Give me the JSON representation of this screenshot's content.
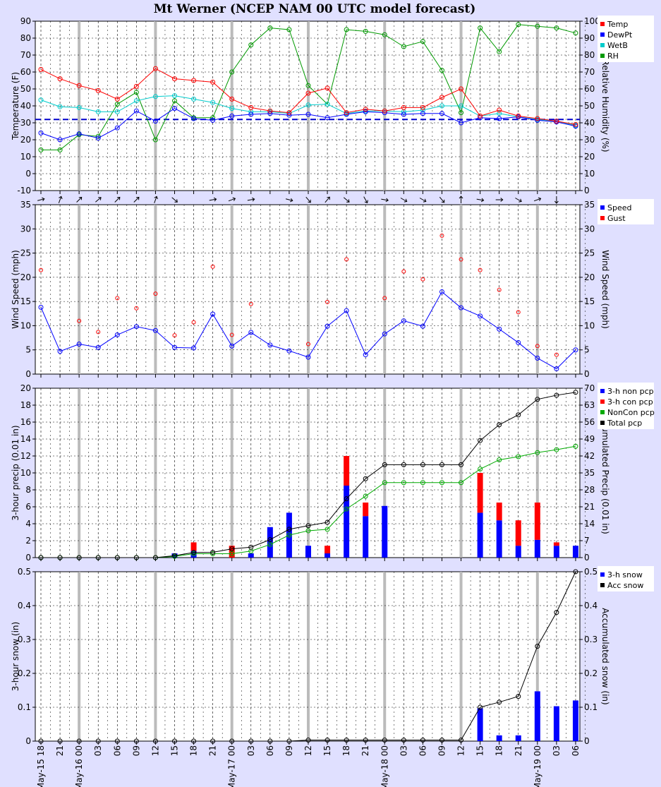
{
  "title": "Mt Werner (NCEP NAM 00 UTC model forecast)",
  "time_labels": [
    "May-15 18",
    "21",
    "May-16 00",
    "03",
    "06",
    "09",
    "12",
    "15",
    "18",
    "21",
    "May-17 00",
    "03",
    "06",
    "09",
    "12",
    "15",
    "18",
    "21",
    "May-18 00",
    "03",
    "06",
    "09",
    "12",
    "15",
    "18",
    "21",
    "May-19 00",
    "03",
    "06"
  ],
  "colors": {
    "background": "#e0e0ff",
    "temp": "#ff0000",
    "dewpt": "#0000ff",
    "wetb": "#00cccc",
    "rh": "#009900",
    "freezing_line": "#0000cc",
    "grid": "#000000",
    "vgrid": "#bbbbbb",
    "legend_bg": "#ffffff"
  },
  "chart_data": [
    {
      "type": "line",
      "panel": "temperature",
      "ylabel": "Temperature (F)",
      "y2label": "Relative Humidity (%)",
      "ylim": [
        -10,
        90
      ],
      "y2lim": [
        0,
        100
      ],
      "yticks": [
        "-10",
        "0",
        "10",
        "20",
        "30",
        "40",
        "50",
        "60",
        "70",
        "80",
        "90"
      ],
      "y2ticks": [
        "0",
        "10",
        "20",
        "30",
        "40",
        "50",
        "60",
        "70",
        "80",
        "90",
        "100"
      ],
      "reference_line": 32,
      "series": [
        {
          "name": "Temp",
          "axis": "left",
          "values": [
            61.5,
            56,
            52,
            49,
            44,
            51.5,
            62,
            56,
            55,
            54,
            44,
            39,
            37,
            36,
            47.5,
            50.5,
            36,
            38,
            37,
            39,
            39,
            45,
            50,
            34,
            37.5,
            34,
            32.5,
            31,
            29
          ]
        },
        {
          "name": "DewPt",
          "axis": "left",
          "values": [
            24,
            20,
            23.5,
            21,
            27,
            37,
            31,
            38.5,
            32.5,
            31.5,
            34,
            35,
            35.5,
            34.5,
            35,
            33,
            35,
            36.5,
            36,
            35,
            35.5,
            35.5,
            30,
            33,
            32.5,
            33.5,
            31.5,
            30.5,
            28
          ]
        },
        {
          "name": "WetB",
          "axis": "left",
          "values": [
            43.5,
            39.5,
            39,
            36.5,
            36.5,
            43,
            45.5,
            46,
            44,
            42,
            38.5,
            36.5,
            36.5,
            35.5,
            40.5,
            41,
            35.5,
            37,
            37,
            36.5,
            37.5,
            40,
            40,
            34,
            35.5,
            33.5,
            32,
            31,
            28.5
          ]
        },
        {
          "name": "RH",
          "axis": "right",
          "values": [
            24,
            24,
            33,
            32,
            51,
            58,
            30,
            53,
            43,
            43,
            70,
            86,
            96,
            95,
            62,
            51,
            95,
            94,
            92,
            85,
            88,
            71,
            46,
            96,
            82,
            98,
            97,
            96,
            93
          ]
        }
      ]
    },
    {
      "type": "scatter",
      "panel": "wind",
      "ylabel": "Wind Speed (mph)",
      "y2label": "Wind Speed (mph)",
      "ylim": [
        0,
        35
      ],
      "yticks": [
        "0",
        "5",
        "10",
        "15",
        "20",
        "25",
        "30",
        "35"
      ],
      "series": [
        {
          "name": "Speed",
          "values": [
            13.8,
            4.7,
            6.2,
            5.5,
            8.1,
            9.8,
            9,
            5.5,
            5.4,
            12.4,
            5.8,
            8.6,
            6,
            4.8,
            3.5,
            9.9,
            13.1,
            4,
            8.3,
            11,
            9.9,
            17,
            13.7,
            12,
            9.3,
            6.5,
            3.3,
            1.1,
            5
          ]
        },
        {
          "name": "Gust",
          "values": [
            21.5,
            null,
            11,
            8.7,
            15.7,
            13.6,
            16.6,
            8,
            10.7,
            22.2,
            8.1,
            14.5,
            null,
            null,
            6.2,
            14.9,
            23.7,
            null,
            15.7,
            21.2,
            19.6,
            28.6,
            23.7,
            21.5,
            17.4,
            12.8,
            5.8,
            4,
            null
          ]
        },
        {
          "name": "Direction",
          "values": [
            255,
            200,
            225,
            230,
            225,
            225,
            200,
            310,
            null,
            260,
            250,
            260,
            null,
            285,
            320,
            220,
            310,
            330,
            280,
            300,
            300,
            320,
            180,
            280,
            270,
            300,
            250,
            0,
            null
          ]
        }
      ]
    },
    {
      "type": "bar",
      "panel": "precip",
      "ylabel": "3-hour precip (0.01 in)",
      "y2label": "Accumulated Precip (0.01 in)",
      "ylim": [
        0,
        20
      ],
      "y2lim": [
        0,
        70
      ],
      "yticks": [
        "0",
        "2",
        "4",
        "6",
        "8",
        "10",
        "12",
        "14",
        "16",
        "18",
        "20"
      ],
      "y2ticks": [
        "0",
        "7",
        "14",
        "21",
        "28",
        "35",
        "42",
        "49",
        "56",
        "63",
        "70"
      ],
      "series": [
        {
          "name": "3-h non pcp",
          "axis": "left",
          "values": [
            0,
            0,
            0,
            0,
            0,
            0,
            0,
            0.5,
            0.8,
            0,
            0,
            0.5,
            3.6,
            5.3,
            1.4,
            0.5,
            8.5,
            4.9,
            6.1,
            0,
            0,
            0,
            0,
            5.3,
            4.4,
            1.4,
            2.1,
            1.4,
            1.4
          ]
        },
        {
          "name": "3-h con pcp",
          "axis": "left",
          "values": [
            0,
            0,
            0,
            0,
            0,
            0,
            0,
            0,
            1,
            0,
            1.4,
            0,
            0,
            0,
            0,
            0.9,
            3.5,
            1.6,
            0,
            0,
            0,
            0,
            0,
            4.7,
            2.1,
            3,
            4.4,
            0.4,
            0
          ]
        },
        {
          "name": "NonCon pcp",
          "axis": "right",
          "values": [
            0,
            0,
            0,
            0,
            0,
            0,
            0,
            0.5,
            1.6,
            1.6,
            1.6,
            2.7,
            5.4,
            9.3,
            11.1,
            11.7,
            20.1,
            25.4,
            31,
            31,
            31,
            31,
            31,
            36.6,
            40.4,
            41.7,
            43.4,
            44.6,
            46
          ]
        },
        {
          "name": "Total pcp",
          "axis": "right",
          "values": [
            0,
            0,
            0,
            0,
            0,
            0,
            0,
            0.8,
            2.1,
            2.2,
            3.6,
            4.3,
            7.4,
            11.7,
            13.2,
            14.6,
            24.3,
            32.6,
            38.4,
            38.4,
            38.4,
            38.4,
            38.4,
            48.4,
            54.9,
            59,
            65.4,
            67.1,
            68.3
          ]
        }
      ]
    },
    {
      "type": "bar",
      "panel": "snow",
      "ylabel": "3-hour snow (in)",
      "y2label": "Accumulated snow (in)",
      "ylim": [
        0,
        0.5
      ],
      "y2lim": [
        0,
        0.5
      ],
      "yticks": [
        "0",
        "0.1",
        "0.2",
        "0.3",
        "0.4",
        "0.5"
      ],
      "y2ticks": [
        "0",
        "0.1",
        "0.2",
        "0.3",
        "0.4",
        "0.5"
      ],
      "series": [
        {
          "name": "3-h snow",
          "axis": "left",
          "values": [
            0,
            0,
            0,
            0,
            0,
            0,
            0,
            0,
            0,
            0,
            0,
            0,
            0,
            0,
            0,
            0,
            0,
            0,
            0,
            0,
            0,
            0,
            0,
            0.097,
            0.017,
            0.017,
            0.147,
            0.103,
            0.12
          ]
        },
        {
          "name": "Acc snow",
          "axis": "right",
          "values": [
            0,
            0,
            0,
            0,
            0,
            0,
            0,
            0,
            0,
            0,
            0,
            0,
            0,
            0,
            0.003,
            0.003,
            0.003,
            0.003,
            0.003,
            0.003,
            0.003,
            0.003,
            0.003,
            0.1,
            0.115,
            0.132,
            0.28,
            0.38,
            0.5
          ]
        }
      ]
    }
  ]
}
